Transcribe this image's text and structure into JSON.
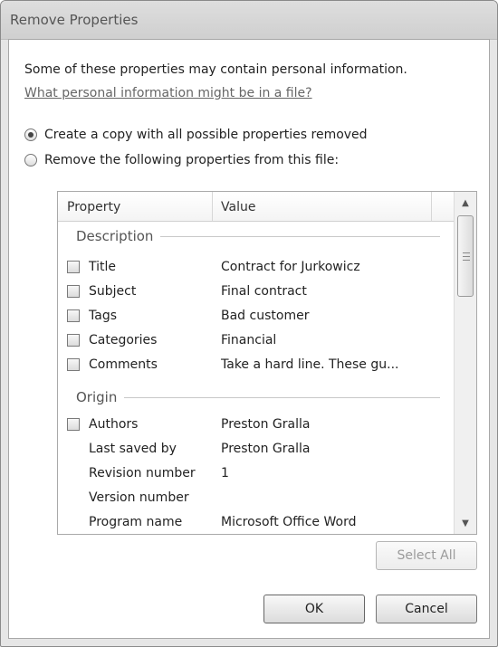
{
  "window": {
    "title": "Remove Properties"
  },
  "intro": {
    "text": "Some of these properties may contain personal information.",
    "help_link": "What personal information might be in a file?"
  },
  "options": [
    {
      "label": "Create a copy with all possible properties removed",
      "checked": true
    },
    {
      "label": "Remove the following properties from this file:",
      "checked": false
    }
  ],
  "list": {
    "columns": [
      "Property",
      "Value"
    ],
    "groups": [
      {
        "name": "Description",
        "rows": [
          {
            "property": "Title",
            "value": "Contract for Jurkowicz",
            "checkbox": true
          },
          {
            "property": "Subject",
            "value": "Final contract",
            "checkbox": true
          },
          {
            "property": "Tags",
            "value": "Bad customer",
            "checkbox": true
          },
          {
            "property": "Categories",
            "value": "Financial",
            "checkbox": true
          },
          {
            "property": "Comments",
            "value": "Take a hard line. These gu...",
            "checkbox": true
          }
        ]
      },
      {
        "name": "Origin",
        "rows": [
          {
            "property": "Authors",
            "value": "Preston Gralla",
            "checkbox": true
          },
          {
            "property": "Last saved by",
            "value": "Preston Gralla",
            "checkbox": false
          },
          {
            "property": "Revision number",
            "value": "1",
            "checkbox": false
          },
          {
            "property": "Version number",
            "value": "",
            "checkbox": false
          },
          {
            "property": "Program name",
            "value": "Microsoft Office Word",
            "checkbox": false
          }
        ]
      }
    ]
  },
  "buttons": {
    "select_all": "Select All",
    "ok": "OK",
    "cancel": "Cancel"
  },
  "colors": {
    "window_bg": "#e6e6e6",
    "client_bg": "#ffffff",
    "link": "#666666"
  }
}
